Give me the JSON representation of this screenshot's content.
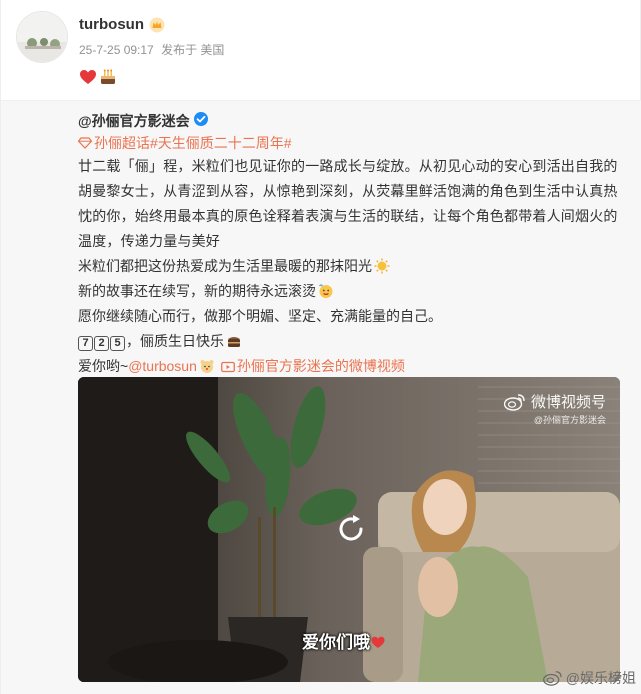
{
  "post": {
    "username": "turbosun",
    "timestamp": "25-7-25 09:17",
    "source": "发布于 美国",
    "emojis": [
      "heart",
      "cake"
    ]
  },
  "repost": {
    "author": "@孙俪官方影迷会",
    "topics": "孙俪超话#天生俪质二十二周年#",
    "para1": "廿二载「俪」程，米粒们也见证你的一路成长与绽放。从初见心动的安心到活出自我的胡曼黎女士，从青涩到从容，从惊艳到深刻，从荧幕里鲜活饱满的角色到生活中认真热忱的你，始终用最本真的原色诠释着表演与生活的联结，让每个角色都带着人间烟火的温度，传递力量与美好",
    "para2": "米粒们都把这份热爱成为生活里最暖的那抹阳光",
    "para3": "新的故事还在续写，新的期待永远滚烫",
    "para4": "愿你继续随心而行，做那个明媚、坚定、充满能量的自己。",
    "keycaps": [
      "7",
      "2",
      "5"
    ],
    "para5": "，俪质生日快乐",
    "para6_prefix": "爱你哟~",
    "mention": "@turbosun",
    "video_link": "孙俪官方影迷会的微博视频"
  },
  "video": {
    "brand_title": "微博视频号",
    "brand_sub": "@孙俪官方影迷会",
    "subtitle": "爱你们哦"
  },
  "watermark": "@娱乐榜姐",
  "colors": {
    "accent": "#eb7350",
    "verify": "#1c8cf6",
    "vip": "#f6a623"
  }
}
